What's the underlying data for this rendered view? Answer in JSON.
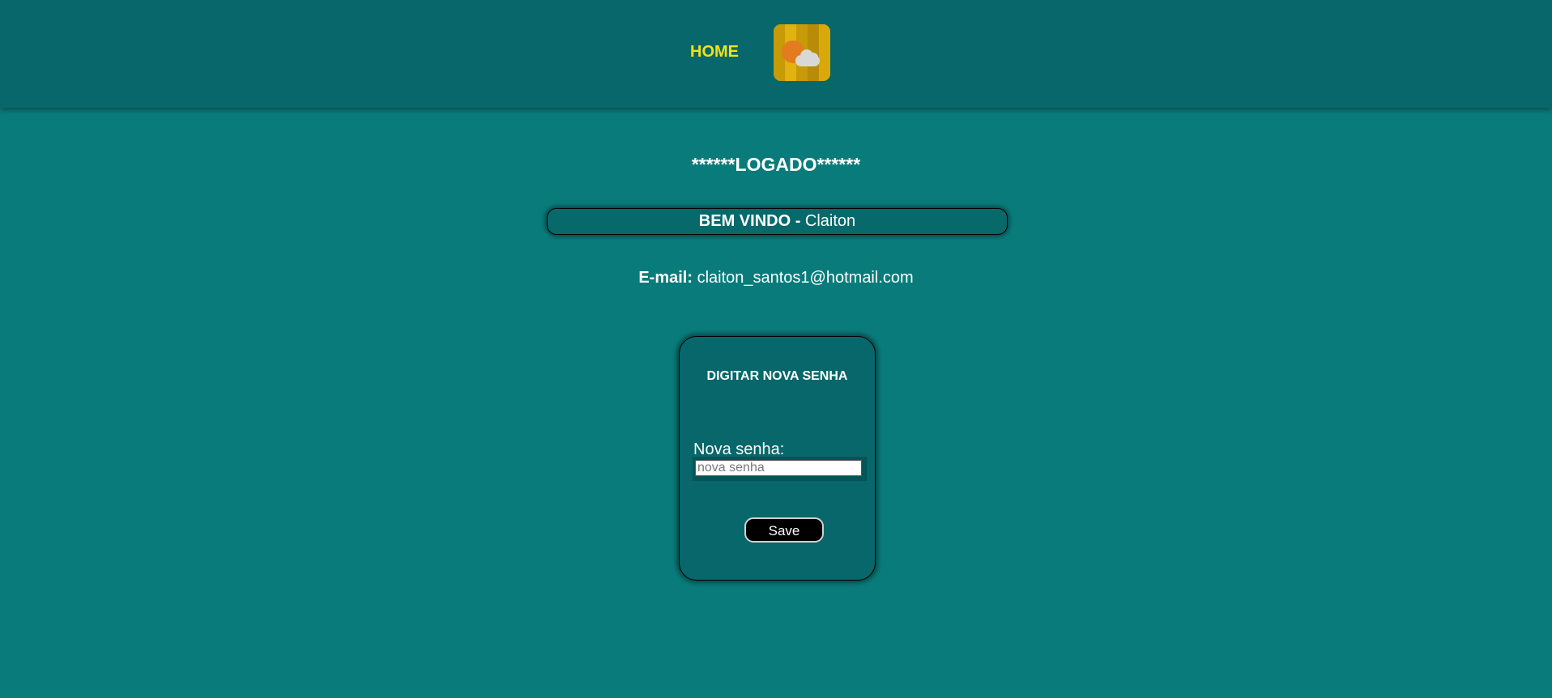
{
  "header": {
    "home_label": "HOME",
    "logo_icon": "weather-sun-cloud-icon"
  },
  "main": {
    "logged_title": "******LOGADO******",
    "welcome_prefix": "BEM VINDO -",
    "welcome_name": "Claiton",
    "email_label": "E-mail:",
    "email_value": "claiton_santos1@hotmail.com"
  },
  "password_form": {
    "title": "DIGITAR NOVA SENHA",
    "field_label": "Nova senha:",
    "field_value": "",
    "field_placeholder": "nova senha",
    "save_label": "Save"
  },
  "colors": {
    "page_bg": "#0a7b7b",
    "header_bg": "#07676a",
    "home_link": "#f2e21a",
    "card_bg": "#07676a",
    "button_bg": "#000000"
  }
}
